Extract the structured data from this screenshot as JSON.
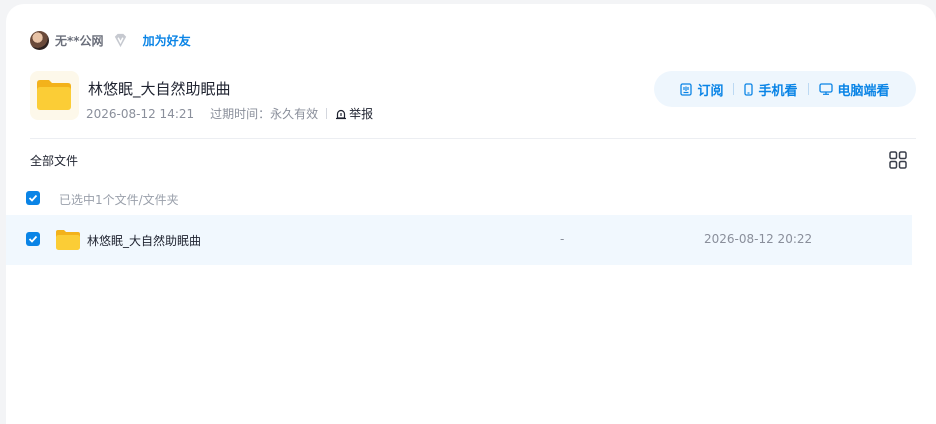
{
  "user": {
    "name": "无**公网",
    "add_friend": "加为好友"
  },
  "share": {
    "title": "林悠眠_大自然助眠曲",
    "created": "2026-08-12 14:21",
    "expire_label": "过期时间：",
    "expire_value": "永久有效",
    "report": "举报"
  },
  "actions": {
    "subscribe": "订阅",
    "mobile": "手机看",
    "desktop": "电脑端看"
  },
  "files_header": {
    "title": "全部文件"
  },
  "selection": {
    "text": "已选中1个文件/文件夹"
  },
  "files": [
    {
      "name": "林悠眠_大自然助眠曲",
      "size": "-",
      "date": "2026-08-12 20:22",
      "checked": true
    }
  ],
  "colors": {
    "accent": "#0a84e6",
    "folder": "#f9c62b",
    "row_highlight": "#f1f8fe"
  }
}
